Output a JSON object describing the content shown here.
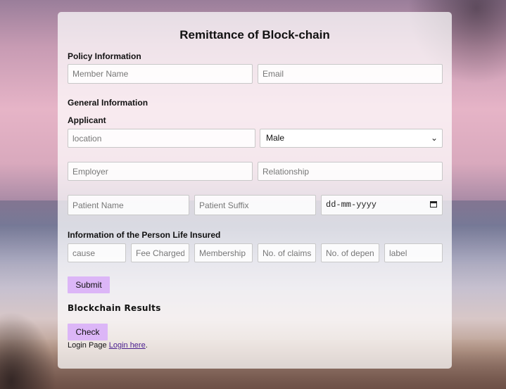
{
  "form": {
    "title": "Remittance of Block-chain",
    "policy_label": "Policy Information",
    "member_name_placeholder": "Member Name",
    "email_placeholder": "Email",
    "general_label": "General Information",
    "applicant_label": "Applicant",
    "location_placeholder": "location",
    "gender_selected": "Male",
    "employer_placeholder": "Employer",
    "relationship_placeholder": "Relationship",
    "patient_name_placeholder": "Patient Name",
    "patient_suffix_placeholder": "Patient Suffix",
    "date_placeholder": "dd-mm-yyyy",
    "insured_label": "Information of the Person Life Insured",
    "cause_placeholder": "cause",
    "fee_placeholder": "Fee Charged",
    "membership_placeholder": "Membership P",
    "claims_placeholder": "No. of claims",
    "dependents_placeholder": "No. of depend",
    "label_placeholder": "label",
    "submit_label": "Submit",
    "results_heading": "Blockchain Results",
    "check_label": "Check",
    "login_text": "Login Page ",
    "login_link": "Login here",
    "login_suffix": "."
  },
  "colors": {
    "button": "#dcb6f7",
    "link": "#4b1f8f"
  },
  "icons": [
    "chevron-down-icon",
    "calendar-icon"
  ]
}
